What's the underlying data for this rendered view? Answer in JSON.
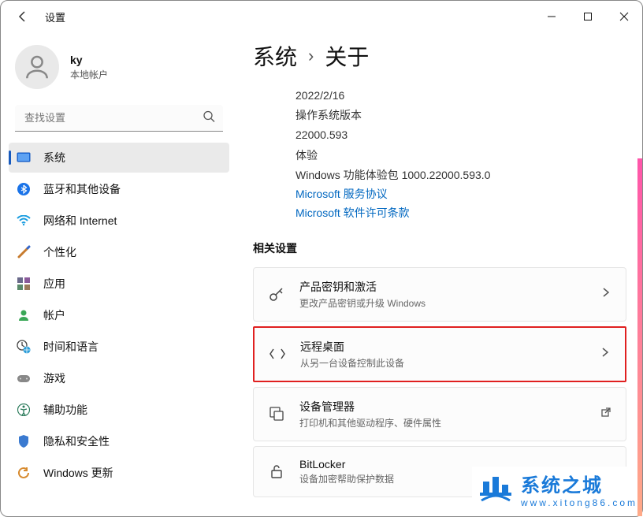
{
  "titlebar": {
    "app_title": "设置"
  },
  "user": {
    "name": "ky",
    "account_type": "本地帐户"
  },
  "search": {
    "placeholder": "查找设置"
  },
  "nav": {
    "system": "系统",
    "bluetooth": "蓝牙和其他设备",
    "network": "网络和 Internet",
    "personalization": "个性化",
    "apps": "应用",
    "accounts": "帐户",
    "time_lang": "时间和语言",
    "gaming": "游戏",
    "accessibility": "辅助功能",
    "privacy": "隐私和安全性",
    "update": "Windows 更新"
  },
  "breadcrumb": {
    "root": "系统",
    "current": "关于"
  },
  "spec": {
    "install_date": "2022/2/16",
    "os_build_label": "操作系统版本",
    "os_build_value": "22000.593",
    "experience_label": "体验",
    "experience_value": "Windows 功能体验包 1000.22000.593.0"
  },
  "links": {
    "service_agreement": "Microsoft 服务协议",
    "license_terms": "Microsoft 软件许可条款"
  },
  "related_title": "相关设置",
  "cards": {
    "activation": {
      "title": "产品密钥和激活",
      "sub": "更改产品密钥或升级 Windows"
    },
    "remote": {
      "title": "远程桌面",
      "sub": "从另一台设备控制此设备"
    },
    "device_mgr": {
      "title": "设备管理器",
      "sub": "打印机和其他驱动程序、硬件属性"
    },
    "bitlocker": {
      "title": "BitLocker",
      "sub": "设备加密帮助保护数据"
    }
  },
  "watermark": {
    "big": "系统之城",
    "small": "www.xitong86.com"
  }
}
